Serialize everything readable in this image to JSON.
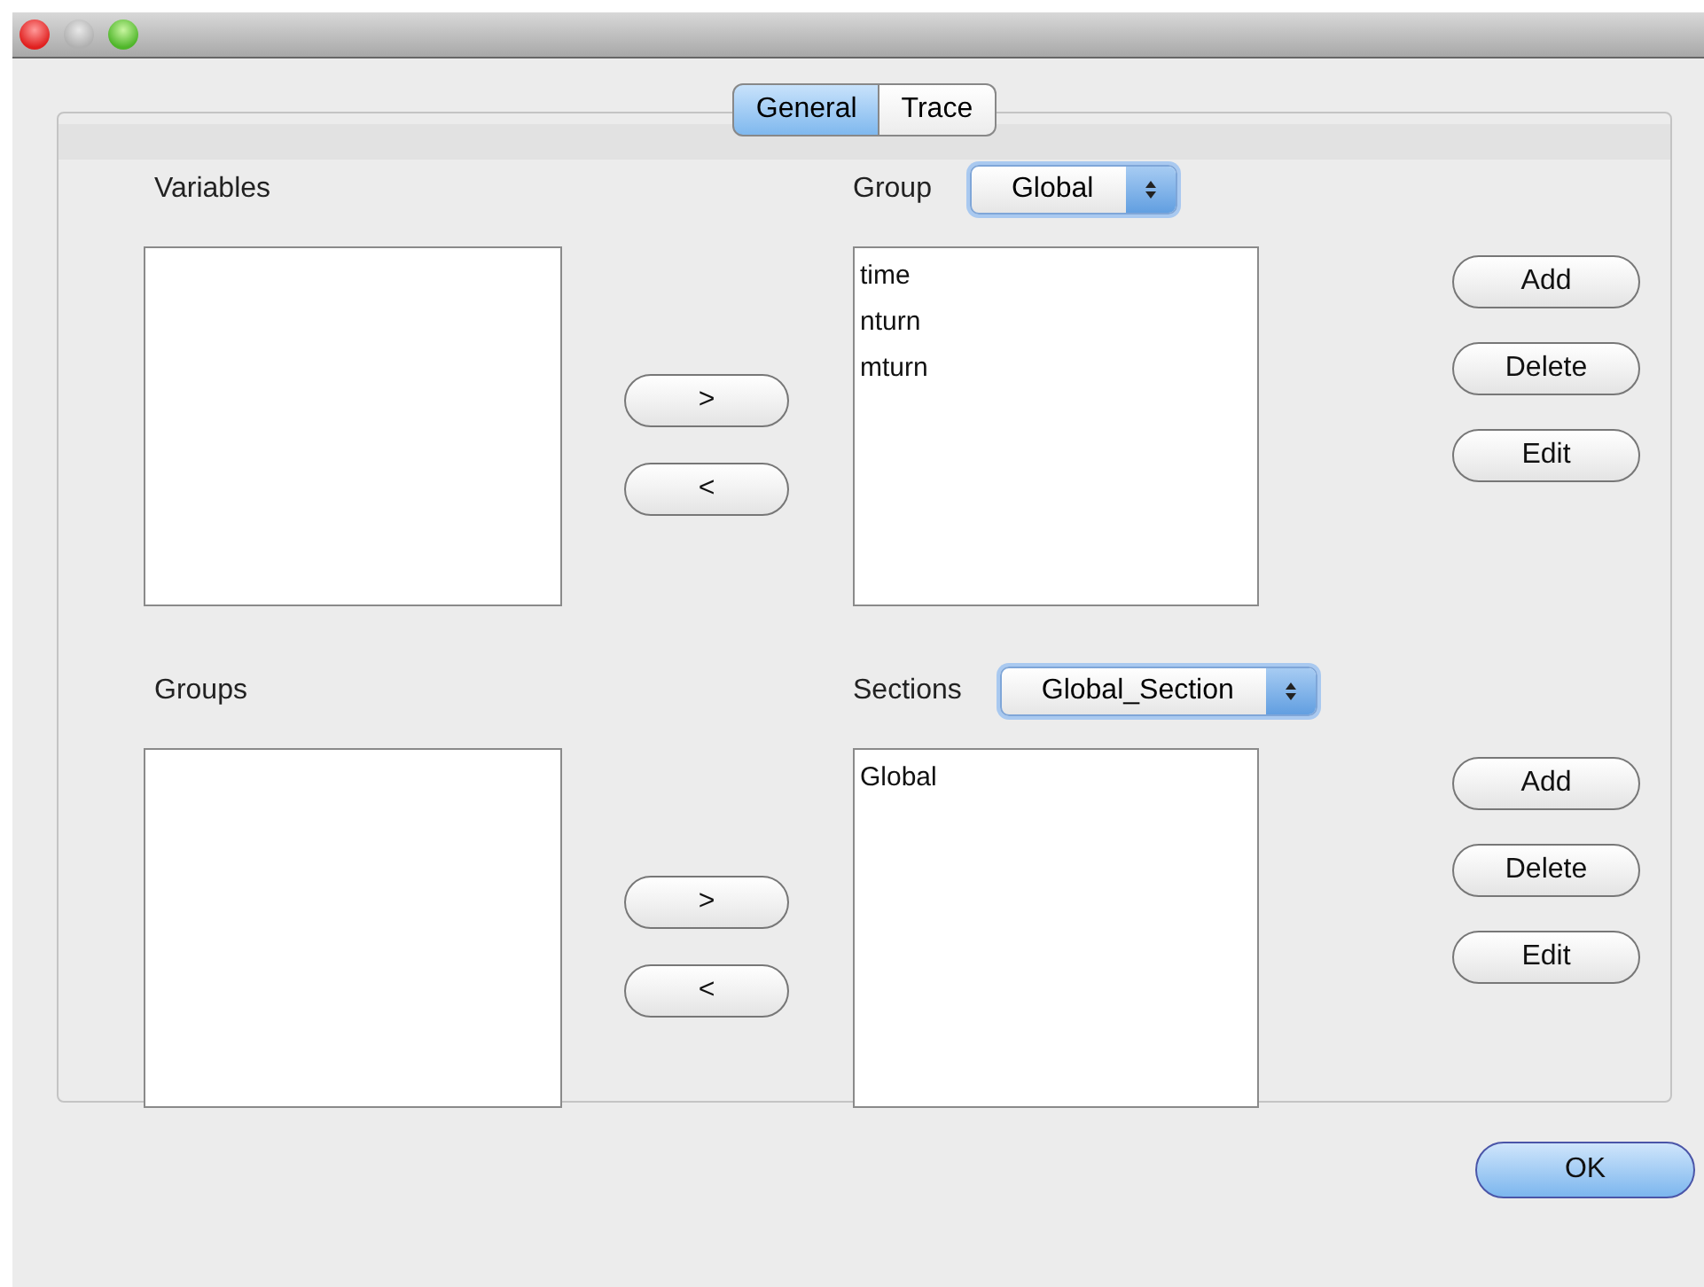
{
  "tabs": [
    {
      "label": "General",
      "selected": true
    },
    {
      "label": "Trace",
      "selected": false
    }
  ],
  "sections": [
    {
      "left_label": "Variables",
      "right_label": "Group",
      "dropdown": "Global",
      "right_items": [
        "time",
        "nturn",
        "mturn"
      ],
      "move_buttons": [
        ">",
        "<"
      ],
      "buttons": [
        "Add",
        "Delete",
        "Edit"
      ]
    },
    {
      "left_label": "Groups",
      "right_label": "Sections",
      "dropdown": "Global_Section",
      "right_items": [
        "Global"
      ],
      "move_buttons": [
        ">",
        "<"
      ],
      "buttons": [
        "Add",
        "Delete",
        "Edit"
      ]
    }
  ],
  "ok_button": "OK"
}
